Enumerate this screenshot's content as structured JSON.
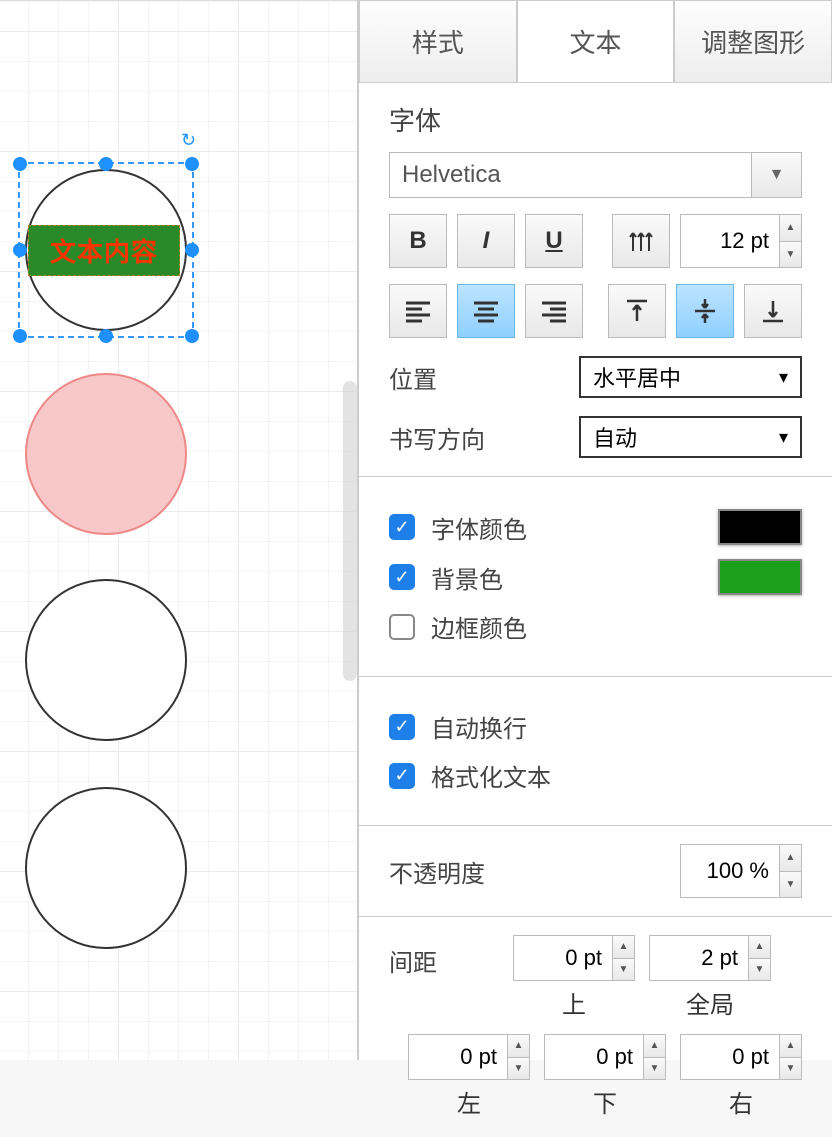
{
  "canvas": {
    "text_content": "文本内容"
  },
  "tabs": {
    "style": "样式",
    "text": "文本",
    "adjust": "调整图形"
  },
  "font": {
    "label": "字体",
    "family": "Helvetica",
    "size": "12 pt"
  },
  "position": {
    "label": "位置",
    "value": "水平居中"
  },
  "direction": {
    "label": "书写方向",
    "value": "自动"
  },
  "colors": {
    "font_label": "字体颜色",
    "font_checked": true,
    "font_color": "#000000",
    "bg_label": "背景色",
    "bg_checked": true,
    "bg_color": "#1aa01a",
    "border_label": "边框颜色",
    "border_checked": false
  },
  "wrap": {
    "auto_label": "自动换行",
    "auto_checked": true,
    "format_label": "格式化文本",
    "format_checked": true
  },
  "opacity": {
    "label": "不透明度",
    "value": "100 %"
  },
  "spacing": {
    "label": "间距",
    "top": {
      "value": "0 pt",
      "label": "上"
    },
    "global": {
      "value": "2 pt",
      "label": "全局"
    },
    "left": {
      "value": "0 pt",
      "label": "左"
    },
    "bottom": {
      "value": "0 pt",
      "label": "下"
    },
    "right": {
      "value": "0 pt",
      "label": "右"
    }
  }
}
